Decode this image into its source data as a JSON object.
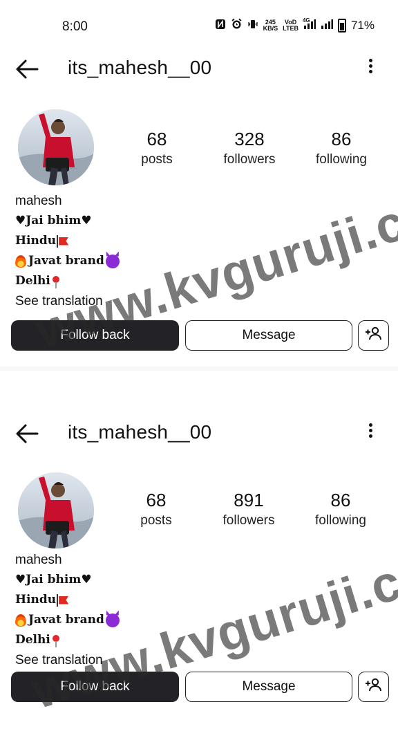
{
  "status_bar": {
    "time": "8:00",
    "speed_top": "245",
    "speed_bottom": "KB/S",
    "volte_top": "VoD",
    "volte_bottom": "LTEB",
    "network": "4G",
    "battery": "71%"
  },
  "panels": [
    {
      "username": "its_mahesh__00",
      "stats": [
        {
          "value": "68",
          "label": "posts"
        },
        {
          "value": "328",
          "label": "followers"
        },
        {
          "value": "86",
          "label": "following"
        }
      ],
      "bio": {
        "name": "mahesh",
        "line1": "♥Jai bhim♥",
        "line2": "Hindu",
        "line3": "Javat brand",
        "line4": "Delhi",
        "see_translation": "See translation"
      },
      "buttons": {
        "follow": "Follow back",
        "message": "Message"
      }
    },
    {
      "username": "its_mahesh__00",
      "stats": [
        {
          "value": "68",
          "label": "posts"
        },
        {
          "value": "891",
          "label": "followers"
        },
        {
          "value": "86",
          "label": "following"
        }
      ],
      "bio": {
        "name": "mahesh",
        "line1": "♥Jai bhim♥",
        "line2": "Hindu",
        "line3": "Javat brand",
        "line4": "Delhi",
        "see_translation": "See translation"
      },
      "buttons": {
        "follow": "Follow back",
        "message": "Message"
      }
    }
  ],
  "watermark": "www.kvguruji.com",
  "icons": {
    "back": "arrow-left-icon",
    "more": "more-vertical-icon",
    "add_person": "add-person-icon"
  }
}
